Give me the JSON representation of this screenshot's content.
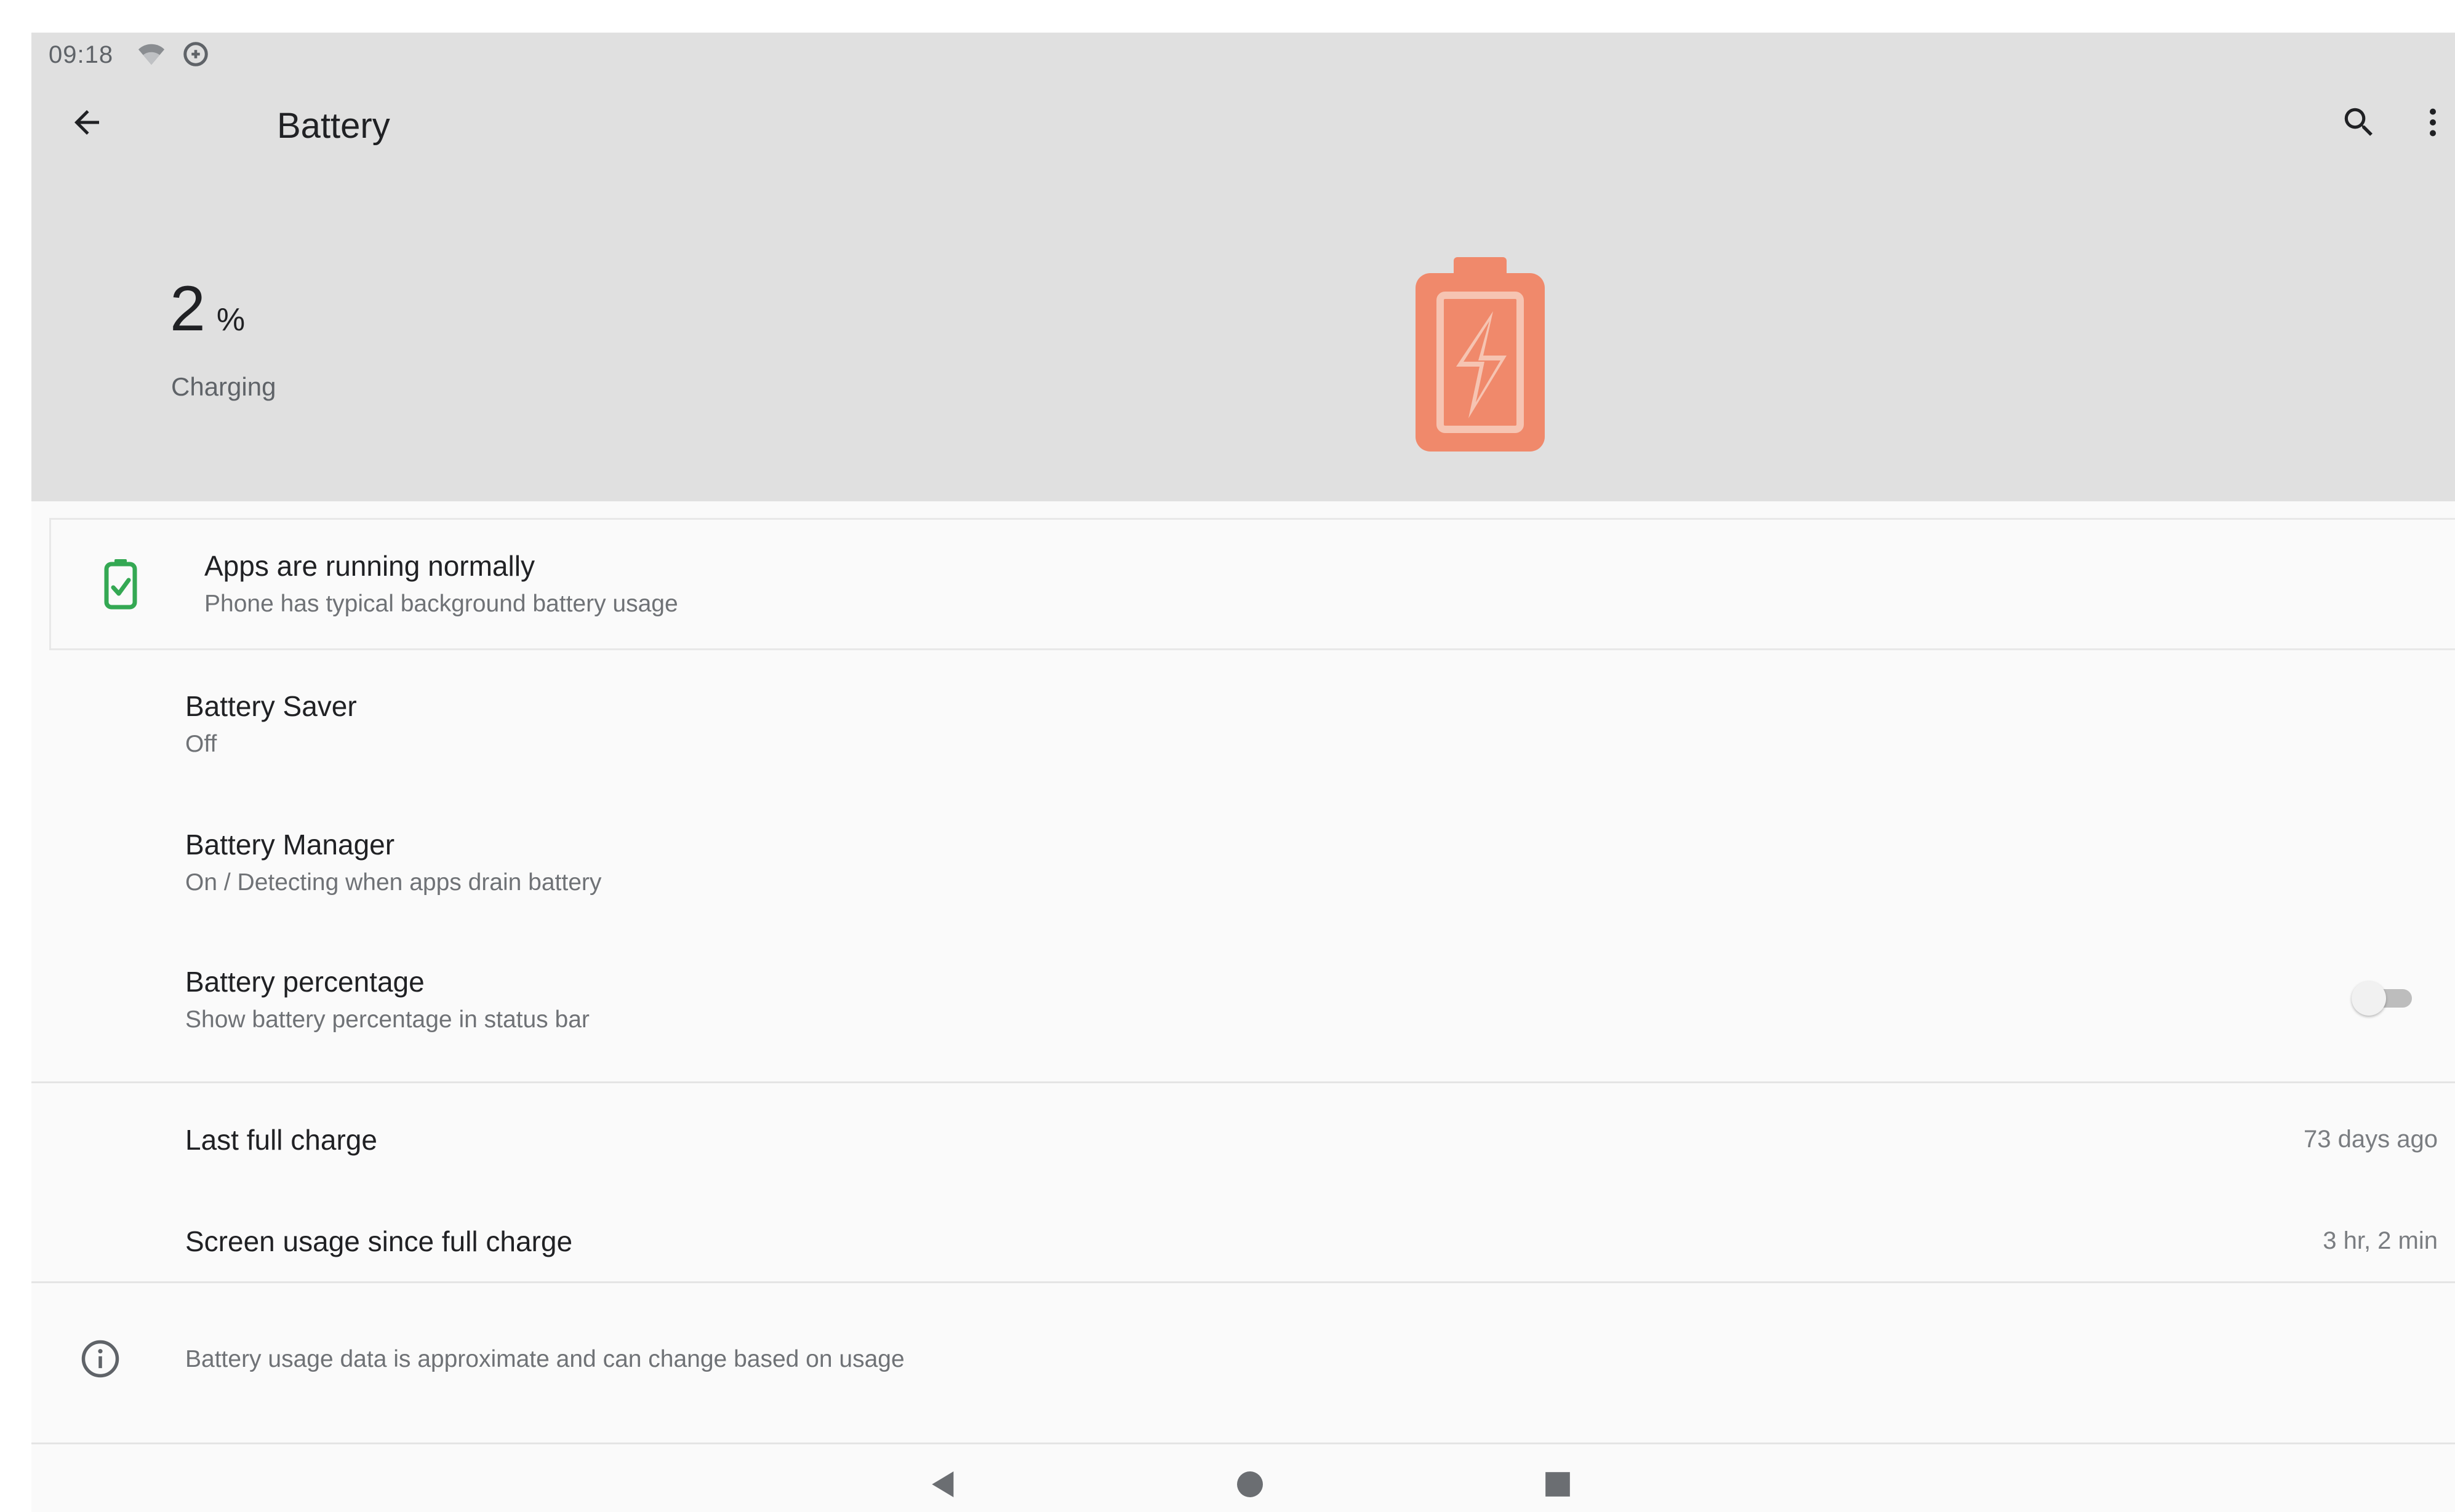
{
  "status_bar": {
    "time": "09:18",
    "icons": [
      "wifi-icon",
      "data-saver-icon"
    ]
  },
  "app_bar": {
    "title": "Battery",
    "back_icon": "arrow-back-icon",
    "search_icon": "search-icon",
    "more_icon": "more-vert-icon"
  },
  "battery": {
    "level": "2",
    "unit": "%",
    "status": "Charging",
    "graphic_color": "#f0896b"
  },
  "tip": {
    "title": "Apps are running normally",
    "summary": "Phone has typical background battery usage",
    "icon": "battery-ok-icon",
    "icon_color": "#34a853"
  },
  "preferences": [
    {
      "title": "Battery Saver",
      "summary": "Off"
    },
    {
      "title": "Battery Manager",
      "summary": "On / Detecting when apps drain battery"
    },
    {
      "title": "Battery percentage",
      "summary": "Show battery percentage in status bar",
      "toggle_on": false
    }
  ],
  "usage": [
    {
      "title": "Last full charge",
      "value": "73 days ago"
    },
    {
      "title": "Screen usage since full charge",
      "value": "3 hr, 2 min"
    }
  ],
  "footer": {
    "text": "Battery usage data is approximate and can change based on usage",
    "icon": "info-icon"
  },
  "nav_bar": {
    "back": "nav-back-icon",
    "home": "nav-home-icon",
    "recents": "nav-recents-icon"
  }
}
